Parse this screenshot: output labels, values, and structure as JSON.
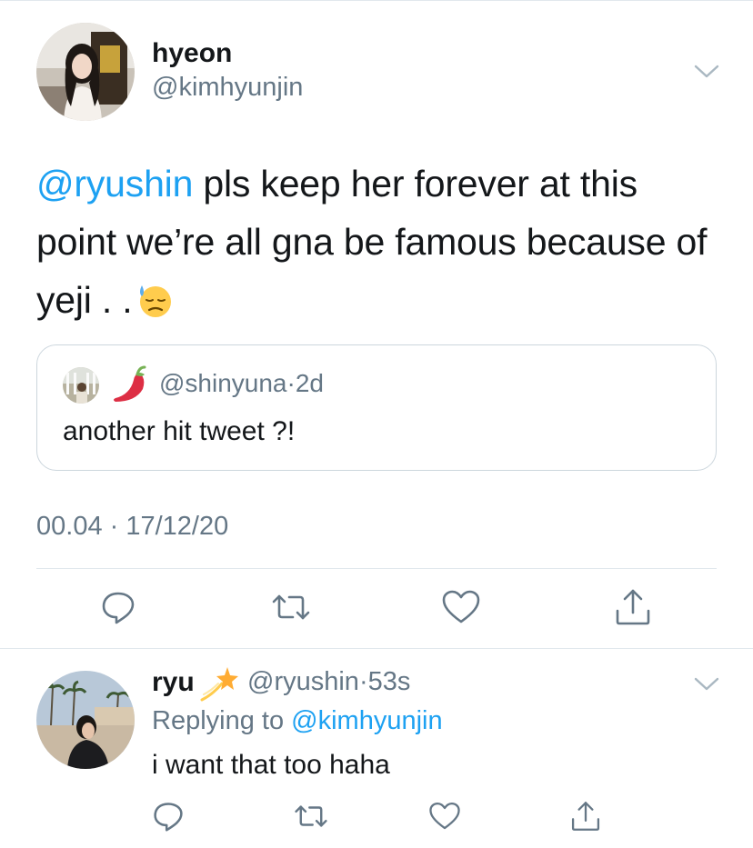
{
  "main_tweet": {
    "author_name": "hyeon",
    "author_handle": "@kimhyunjin",
    "mention": "@ryushin",
    "text": " pls keep her forever at this point we’re all gna be famous because of yeji . .",
    "emoji": "downcast-face-with-sweat",
    "quoted_tweet": {
      "handle": "@shinyuna",
      "separator": "·",
      "time": "2d",
      "emoji": "hot-pepper",
      "text": "another hit tweet ?!"
    },
    "timestamp": "00.04 · 17/12/20"
  },
  "reply_tweet": {
    "author_name": "ryu",
    "author_emoji": "dizzy-sparkle",
    "author_handle": "@ryushin",
    "separator": "·",
    "time": "53s",
    "replying_label": "Replying to ",
    "replying_handle": "@kimhyunjin",
    "text": "i want that too haha"
  },
  "colors": {
    "link": "#1da1f2",
    "secondary_text": "#657786",
    "primary_text": "#14171a",
    "divider": "#e1e8ed"
  },
  "icons": [
    "chevron-down-icon",
    "reply-icon",
    "retweet-icon",
    "like-icon",
    "share-icon"
  ]
}
